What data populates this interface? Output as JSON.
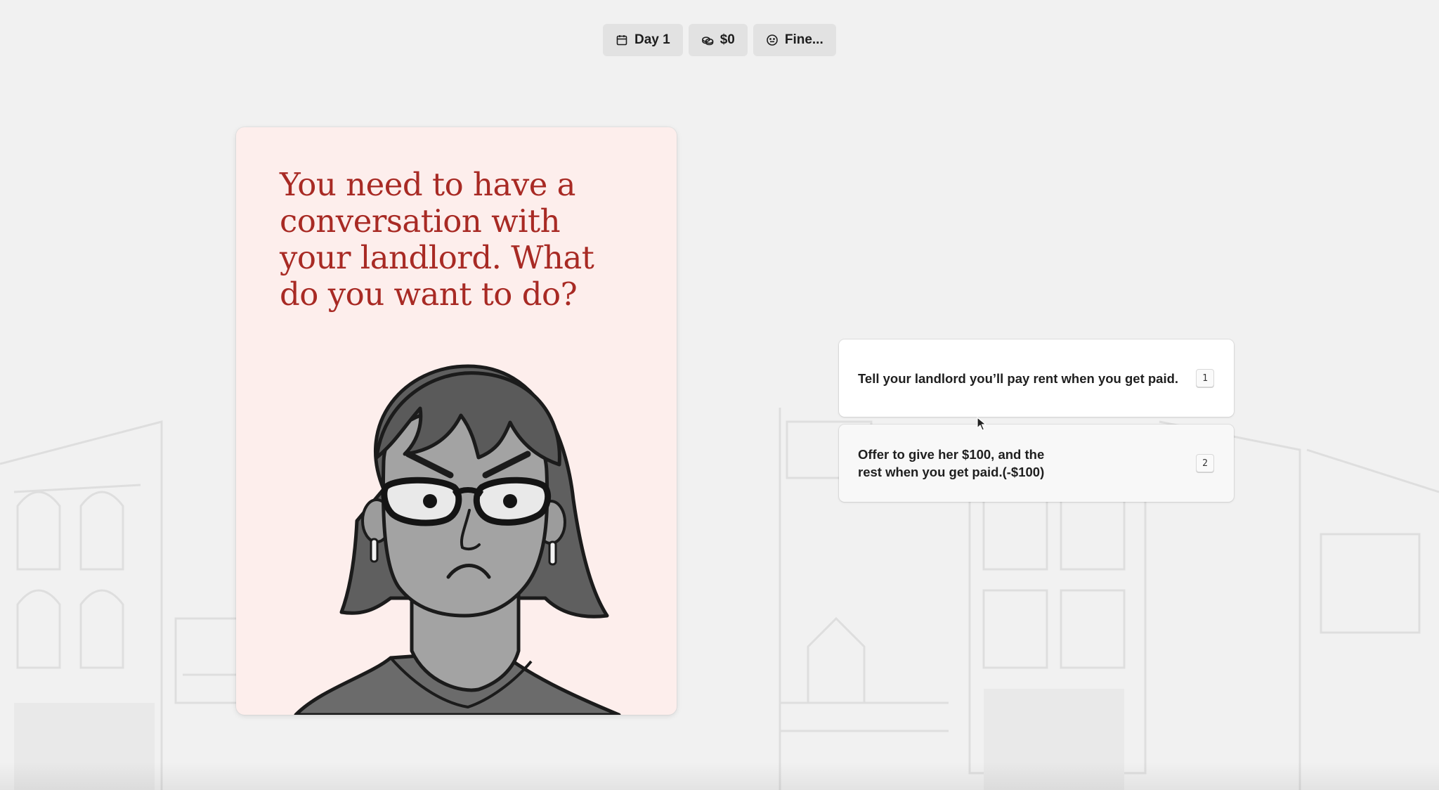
{
  "status": {
    "day_label": "Day 1",
    "money_label": "$0",
    "mood_label": "Fine..."
  },
  "card": {
    "prompt": "You need to have a conversation with your landlord. What do you want to do?",
    "portrait": "landlord-portrait"
  },
  "choices": [
    {
      "text": "Tell your landlord you’ll pay rent when you get paid.",
      "key": "1"
    },
    {
      "text": "Offer to give her $100, and the rest when you get paid.(-$100)",
      "key": "2"
    }
  ],
  "icons": {
    "day": "calendar-icon",
    "money": "coins-icon",
    "mood": "smiley-icon"
  },
  "colors": {
    "prompt_text": "#a82a24",
    "card_bg": "#fdeeec",
    "page_bg": "#f1f1f1",
    "pill_bg": "#e2e2e2"
  }
}
